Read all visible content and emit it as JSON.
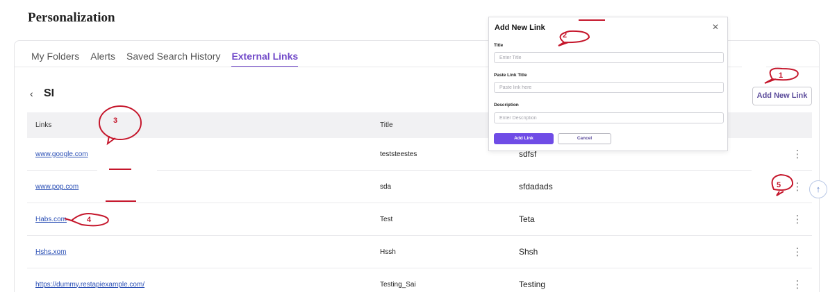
{
  "page": {
    "title": "Personalization"
  },
  "tabs": [
    {
      "label": "My Folders",
      "active": false
    },
    {
      "label": "Alerts",
      "active": false
    },
    {
      "label": "Saved Search History",
      "active": false
    },
    {
      "label": "External Links",
      "active": true
    }
  ],
  "folder": {
    "back_icon": "chevron-left-icon",
    "name": "SI"
  },
  "toolbar": {
    "add_new_link_label": "Add New Link"
  },
  "table": {
    "headers": {
      "links": "Links",
      "title": "Title"
    },
    "rows": [
      {
        "link": "www.google.com",
        "title": "teststeestes",
        "description": "sdfsf"
      },
      {
        "link": "www.pop.com",
        "title": "sda",
        "description": "sfdadads"
      },
      {
        "link": "Habs.com",
        "title": "Test",
        "description": "Teta"
      },
      {
        "link": "Hshs.xom",
        "title": "Hssh",
        "description": "Shsh"
      },
      {
        "link": "https://dummy.restapiexample.com/",
        "title": "Testing_Sai",
        "description": "Testing"
      }
    ],
    "row_action_icon": "kebab-menu-icon"
  },
  "modal": {
    "title": "Add New Link",
    "close_icon": "close-icon",
    "fields": {
      "title": {
        "label": "Title",
        "placeholder": "Enter Title",
        "value": ""
      },
      "link": {
        "label": "Paste Link Title",
        "placeholder": "Paste link here",
        "value": ""
      },
      "description": {
        "label": "Description",
        "placeholder": "Enter Description",
        "value": ""
      }
    },
    "submit_label": "Add Link",
    "cancel_label": "Cancel"
  },
  "scroll_top_icon": "arrow-up-icon",
  "annotations": [
    "1",
    "2",
    "3",
    "4",
    "5"
  ],
  "colors": {
    "accent": "#7048c8",
    "primary_button": "#6f4ce6",
    "link": "#2a4fb5",
    "annotation": "#c5162b",
    "header_bg": "#f1f1f3"
  }
}
